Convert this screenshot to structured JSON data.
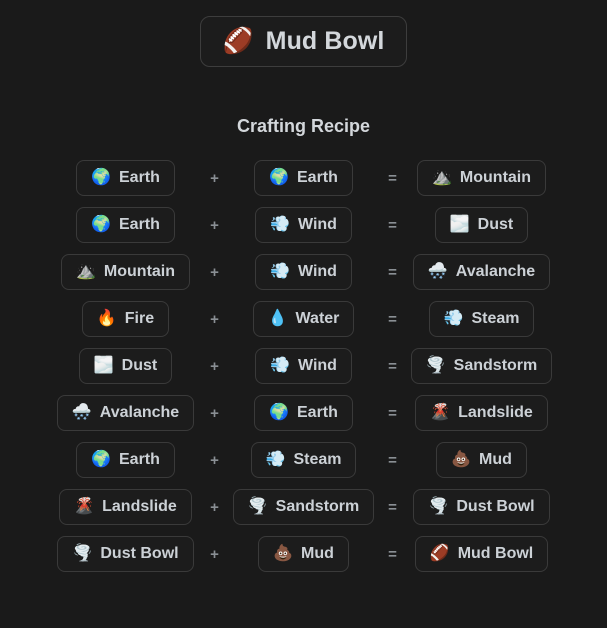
{
  "header": {
    "icon": "american-football-emoji",
    "icon_glyph": "🏈",
    "title": "Mud Bowl"
  },
  "section": {
    "heading": "Crafting Recipe"
  },
  "operators": {
    "plus": "+",
    "equals": "="
  },
  "colors": {
    "background": "#1a1a1a",
    "pill_background": "#1c1c1c",
    "pill_border": "#3a3a3a",
    "text": "#ccd1d6",
    "operator": "#8a8f94"
  },
  "recipes": [
    {
      "input_a": {
        "glyph": "🌍",
        "icon": "earth-globe-emoji",
        "label": "Earth"
      },
      "input_b": {
        "glyph": "🌍",
        "icon": "earth-globe-emoji",
        "label": "Earth"
      },
      "output": {
        "glyph": "⛰️",
        "icon": "mountain-emoji",
        "label": "Mountain"
      }
    },
    {
      "input_a": {
        "glyph": "🌍",
        "icon": "earth-globe-emoji",
        "label": "Earth"
      },
      "input_b": {
        "glyph": "💨",
        "icon": "dash-wind-emoji",
        "label": "Wind"
      },
      "output": {
        "glyph": "🌫️",
        "icon": "fog-waves-emoji",
        "label": "Dust"
      }
    },
    {
      "input_a": {
        "glyph": "⛰️",
        "icon": "mountain-emoji",
        "label": "Mountain"
      },
      "input_b": {
        "glyph": "💨",
        "icon": "dash-wind-emoji",
        "label": "Wind"
      },
      "output": {
        "glyph": "🌨️",
        "icon": "snow-cloud-emoji",
        "label": "Avalanche"
      }
    },
    {
      "input_a": {
        "glyph": "🔥",
        "icon": "fire-emoji",
        "label": "Fire"
      },
      "input_b": {
        "glyph": "💧",
        "icon": "water-droplet-emoji",
        "label": "Water"
      },
      "output": {
        "glyph": "💨",
        "icon": "dash-wind-emoji",
        "label": "Steam"
      }
    },
    {
      "input_a": {
        "glyph": "🌫️",
        "icon": "fog-waves-emoji",
        "label": "Dust"
      },
      "input_b": {
        "glyph": "💨",
        "icon": "dash-wind-emoji",
        "label": "Wind"
      },
      "output": {
        "glyph": "🌪️",
        "icon": "tornado-emoji",
        "label": "Sandstorm"
      }
    },
    {
      "input_a": {
        "glyph": "🌨️",
        "icon": "snow-cloud-emoji",
        "label": "Avalanche"
      },
      "input_b": {
        "glyph": "🌍",
        "icon": "earth-globe-emoji",
        "label": "Earth"
      },
      "output": {
        "glyph": "🌋",
        "icon": "volcano-emoji",
        "label": "Landslide"
      }
    },
    {
      "input_a": {
        "glyph": "🌍",
        "icon": "earth-globe-emoji",
        "label": "Earth"
      },
      "input_b": {
        "glyph": "💨",
        "icon": "dash-wind-emoji",
        "label": "Steam"
      },
      "output": {
        "glyph": "💩",
        "icon": "pile-of-poo-emoji",
        "label": "Mud"
      }
    },
    {
      "input_a": {
        "glyph": "🌋",
        "icon": "volcano-emoji",
        "label": "Landslide"
      },
      "input_b": {
        "glyph": "🌪️",
        "icon": "tornado-emoji",
        "label": "Sandstorm"
      },
      "output": {
        "glyph": "🌪️",
        "icon": "tornado-emoji",
        "label": "Dust Bowl"
      }
    },
    {
      "input_a": {
        "glyph": "🌪️",
        "icon": "tornado-emoji",
        "label": "Dust Bowl"
      },
      "input_b": {
        "glyph": "💩",
        "icon": "pile-of-poo-emoji",
        "label": "Mud"
      },
      "output": {
        "glyph": "🏈",
        "icon": "american-football-emoji",
        "label": "Mud Bowl"
      }
    }
  ]
}
